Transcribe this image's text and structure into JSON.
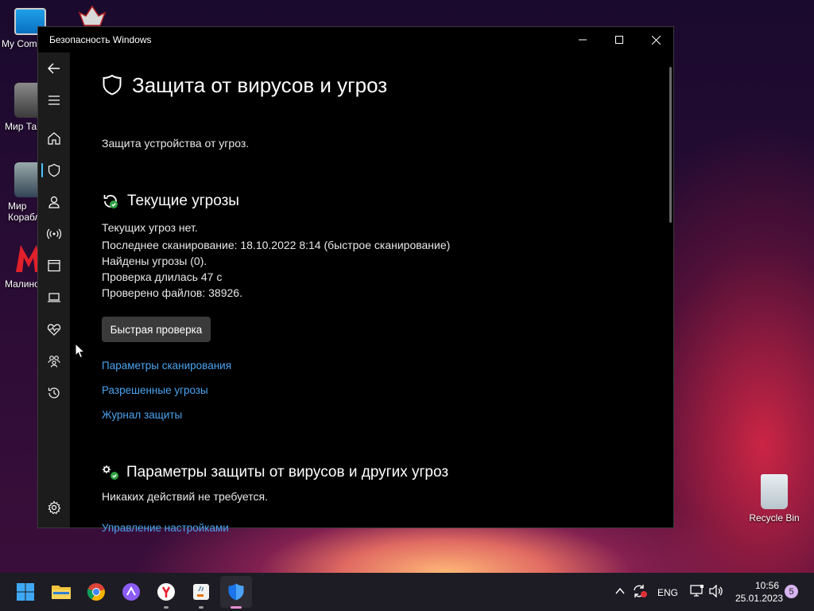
{
  "desktop": {
    "icons": [
      {
        "label": "My Com"
      },
      {
        "label": "Мир Та"
      },
      {
        "label": "Мир Корабл"
      },
      {
        "label": "Малино"
      },
      {
        "label": "Recycle Bin"
      }
    ]
  },
  "window": {
    "title": "Безопасность Windows",
    "heading": "Защита от вирусов и угроз",
    "subtitle": "Защита устройства от угроз.",
    "current_threats": {
      "heading": "Текущие угрозы",
      "lines": [
        "Текущих угроз нет.",
        "Последнее сканирование: 18.10.2022 8:14 (быстрое сканирование)",
        "Найдены угрозы (0).",
        "Проверка длилась 47 с",
        "Проверено файлов: 38926."
      ],
      "quick_scan_button": "Быстрая проверка",
      "links": [
        "Параметры сканирования",
        "Разрешенные угрозы",
        "Журнал защиты"
      ]
    },
    "settings_section": {
      "heading": "Параметры защиты от вирусов и других угроз",
      "status": "Никаких действий не требуется.",
      "link": "Управление настройками"
    }
  },
  "taskbar": {
    "language": "ENG",
    "time": "10:56",
    "date": "25.01.2023",
    "notification_count": "5"
  },
  "colors": {
    "accent": "#4cc2ff",
    "link": "#4aa3f0",
    "ok_green": "#2ea043"
  }
}
